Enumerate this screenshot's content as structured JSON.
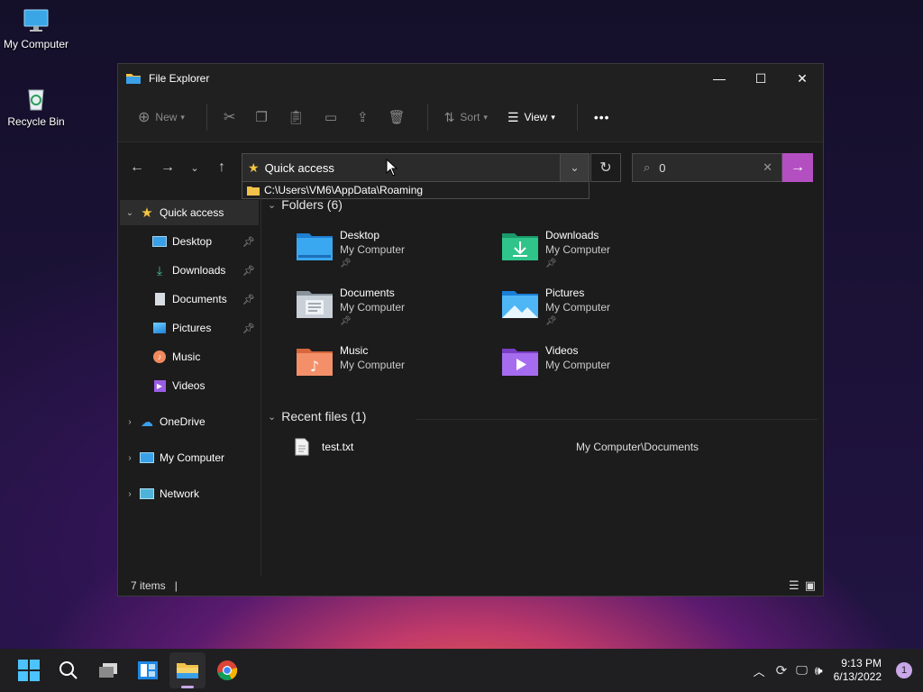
{
  "desktop": {
    "icons": [
      {
        "label": "My Computer"
      },
      {
        "label": "Recycle Bin"
      }
    ]
  },
  "window": {
    "title": "File Explorer",
    "controls": {
      "minimize": "—",
      "maximize": "☐",
      "close": "✕"
    }
  },
  "toolbar": {
    "new_label": "New",
    "sort_label": "Sort",
    "view_label": "View",
    "more_label": "•••"
  },
  "nav": {
    "address_text": "Quick access",
    "suggestion_text": "C:\\Users\\VM6\\AppData\\Roaming",
    "search_value": "0"
  },
  "sidebar": {
    "items": [
      {
        "label": "Quick access"
      },
      {
        "label": "Desktop"
      },
      {
        "label": "Downloads"
      },
      {
        "label": "Documents"
      },
      {
        "label": "Pictures"
      },
      {
        "label": "Music"
      },
      {
        "label": "Videos"
      },
      {
        "label": "OneDrive"
      },
      {
        "label": "My Computer"
      },
      {
        "label": "Network"
      }
    ]
  },
  "content": {
    "folders_header": "Folders (6)",
    "folders": [
      {
        "name": "Desktop",
        "location": "My Computer",
        "pinned": true
      },
      {
        "name": "Downloads",
        "location": "My Computer",
        "pinned": true
      },
      {
        "name": "Documents",
        "location": "My Computer",
        "pinned": true
      },
      {
        "name": "Pictures",
        "location": "My Computer",
        "pinned": true
      },
      {
        "name": "Music",
        "location": "My Computer",
        "pinned": false
      },
      {
        "name": "Videos",
        "location": "My Computer",
        "pinned": false
      }
    ],
    "recent_header": "Recent files (1)",
    "recent": [
      {
        "name": "test.txt",
        "path": "My Computer\\Documents"
      }
    ]
  },
  "status": {
    "items_count": "7 items",
    "divider": "|"
  },
  "taskbar": {
    "time": "9:13 PM",
    "date": "6/13/2022",
    "notification_count": "1"
  },
  "colors": {
    "accent": "#b44fc2",
    "folder_blue": "#3aa0e8",
    "window_bg": "#1c1c1c"
  }
}
